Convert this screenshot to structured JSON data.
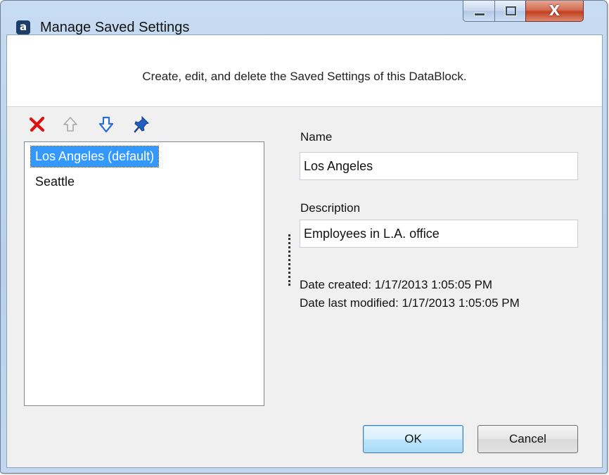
{
  "window": {
    "title": "Manage Saved Settings",
    "app_icon_letter": "a",
    "controls": {
      "minimize": "minimize-icon",
      "maximize": "maximize-icon",
      "close": "close-icon",
      "close_glyph": "X"
    }
  },
  "banner": {
    "text": "Create, edit, and delete the Saved Settings of this DataBlock."
  },
  "toolbar": {
    "icons": [
      "delete-icon",
      "move-up-icon",
      "move-down-icon",
      "pin-icon"
    ],
    "colors": {
      "delete": "#e01010",
      "up": "#b8b8b8",
      "down": "#2b6fd6",
      "pin": "#1f5fc0"
    }
  },
  "settings_list": {
    "items": [
      {
        "label": "Los Angeles (default)",
        "selected": true
      },
      {
        "label": "Seattle",
        "selected": false
      }
    ],
    "selected_color": "#3399ff"
  },
  "details": {
    "name_label": "Name",
    "name_value": "Los Angeles",
    "description_label": "Description",
    "description_value": "Employees in L.A. office",
    "date_created": "Date created: 1/17/2013 1:05:05 PM",
    "date_modified": "Date last modified: 1/17/2013 1:05:05 PM"
  },
  "buttons": {
    "ok_label": "OK",
    "cancel_label": "Cancel"
  }
}
